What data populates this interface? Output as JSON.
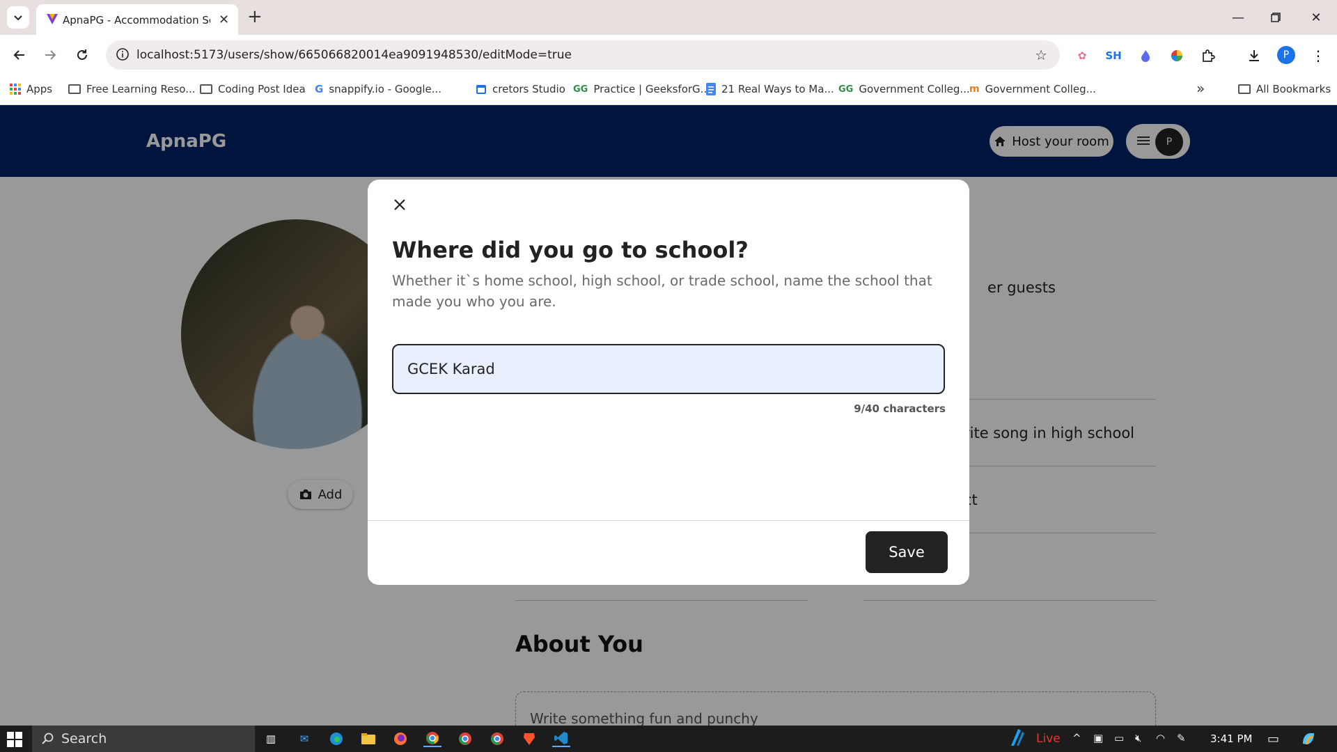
{
  "browser": {
    "tab_title": "ApnaPG - Accommodation Solu",
    "url": "localhost:5173/users/show/665066820014ea9091948530/editMode=true",
    "profile_initial": "P",
    "extensions": [
      "SH"
    ]
  },
  "bookmarks": [
    {
      "label": "Apps",
      "icon": "apps-grid-icon"
    },
    {
      "label": "Free Learning Reso...",
      "icon": "folder-icon"
    },
    {
      "label": "Coding Post Idea",
      "icon": "folder-icon"
    },
    {
      "label": "snappify.io - Google...",
      "icon": "google-icon"
    },
    {
      "label": "cretors Studio",
      "icon": "calendar-icon"
    },
    {
      "label": "Practice | GeeksforG...",
      "icon": "gfg-icon"
    },
    {
      "label": "21 Real Ways to Ma...",
      "icon": "doc-icon"
    },
    {
      "label": "Government Colleg...",
      "icon": "gfg-icon"
    },
    {
      "label": "Government Colleg...",
      "icon": "site-icon"
    }
  ],
  "bookmarks_more": "»",
  "all_bookmarks": "All Bookmarks",
  "app": {
    "brand": "ApnaPG",
    "host_button": "Host your room",
    "user_initial": "P",
    "add_photo": "Add"
  },
  "background": {
    "snippet_1": "er guests",
    "snippet_2": "rite song in high school",
    "snippet_3": "ct",
    "about_heading": "About You",
    "about_placeholder": "Write something fun and punchy"
  },
  "modal": {
    "title": "Where did you go to school?",
    "description": "Whether it`s home school, high school, or trade school, name the school that made you who you are.",
    "input_value": "GCEK Karad",
    "char_count": "9/40 characters",
    "save_label": "Save"
  },
  "taskbar": {
    "search_label": "Search",
    "live_label": "Live",
    "time": "3:41 PM"
  }
}
